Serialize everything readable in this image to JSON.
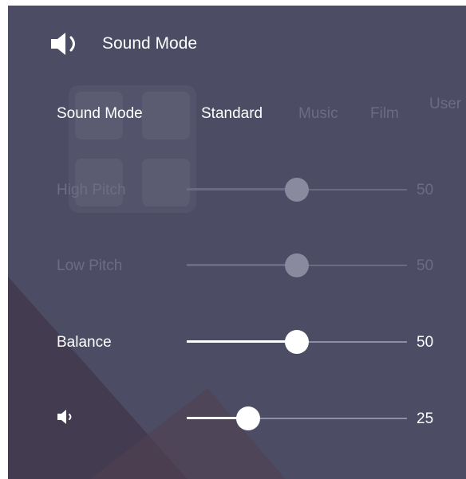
{
  "header": {
    "title": "Sound Mode",
    "icon": "speaker-icon"
  },
  "sound_mode": {
    "label": "Sound Mode",
    "options": [
      "Standard",
      "Music",
      "Film",
      "User"
    ],
    "selected": "Standard"
  },
  "sliders": [
    {
      "label": "High Pitch",
      "value": "50",
      "level": 0.5,
      "enabled": false
    },
    {
      "label": "Low Pitch",
      "value": "50",
      "level": 0.5,
      "enabled": false
    },
    {
      "label": "Balance",
      "value": "50",
      "level": 0.5,
      "enabled": true
    },
    {
      "label": "",
      "icon": "volume-icon",
      "value": "25",
      "level": 0.28,
      "enabled": true
    }
  ],
  "colors": {
    "panel_bg": "#4c4c65",
    "active_text": "#ffffff",
    "disabled_text": "#6c6c84",
    "active_knob": "#ffffff",
    "disabled_knob": "#8a8a9e"
  }
}
